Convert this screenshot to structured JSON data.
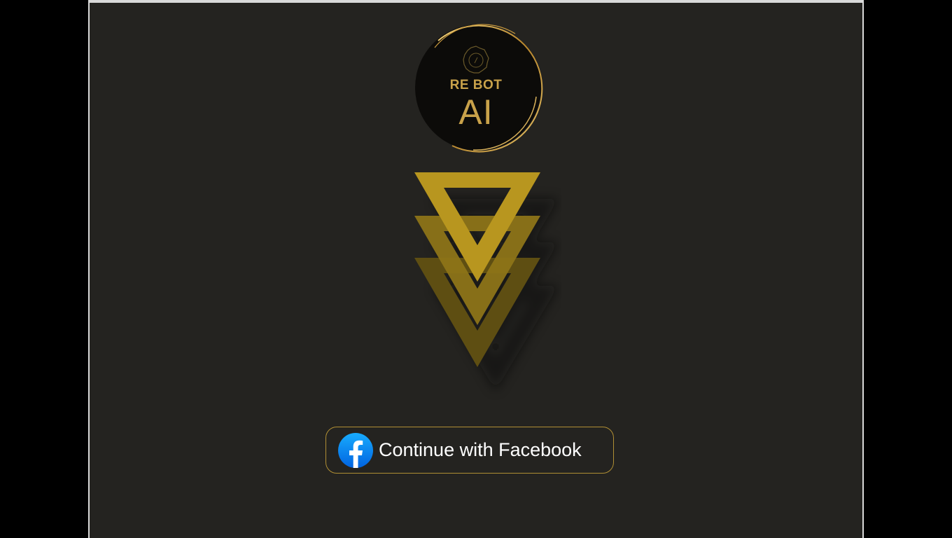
{
  "brand": {
    "line1": "RE BOT",
    "line2": "AI",
    "logo_icon": "gear-badge-icon",
    "accent_color": "#c9a24a"
  },
  "emblem": {
    "icon": "stacked-triangles-icon",
    "colors": [
      "#b8961f",
      "#8d7418",
      "#5e4e12"
    ]
  },
  "login": {
    "facebook_button_label": "Continue with Facebook",
    "facebook_icon": "facebook-icon",
    "facebook_color": "#1877f2",
    "border_color": "#b08f34"
  },
  "theme": {
    "background": "#242320"
  }
}
